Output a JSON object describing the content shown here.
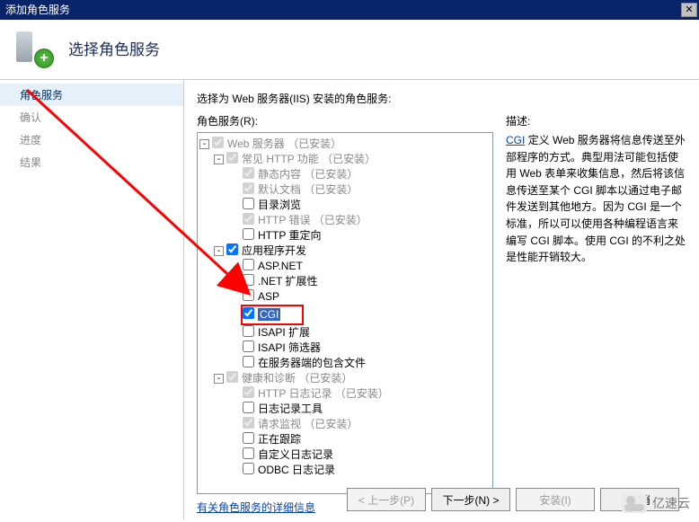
{
  "window": {
    "title": "添加角色服务"
  },
  "header": {
    "title": "选择角色服务"
  },
  "sidebar": {
    "items": [
      {
        "label": "角色服务",
        "active": true
      },
      {
        "label": "确认"
      },
      {
        "label": "进度"
      },
      {
        "label": "结果"
      }
    ]
  },
  "main": {
    "instruction": "选择为 Web 服务器(IIS) 安装的角色服务:",
    "tree_label": "角色服务(R):",
    "info_link": "有关角色服务的详细信息",
    "desc_title": "描述:",
    "desc_link": "CGI",
    "desc_body": " 定义 Web 服务器将信息传送至外部程序的方式。典型用法可能包括使用 Web 表单来收集信息，然后将该信息传送至某个 CGI 脚本以通过电子邮件发送到其他地方。因为 CGI 是一个标准，所以可以使用各种编程语言来编写 CGI 脚本。使用 CGI 的不利之处是性能开销较大。"
  },
  "tree": {
    "root": {
      "label": "Web 服务器",
      "suffix": "（已安装）"
    },
    "http": {
      "label": "常见 HTTP 功能",
      "suffix": "（已安装）",
      "items": [
        {
          "label": "静态内容",
          "suffix": "（已安装）",
          "checked": true,
          "disabled": true
        },
        {
          "label": "默认文档",
          "suffix": "（已安装）",
          "checked": true,
          "disabled": true
        },
        {
          "label": "目录浏览",
          "checked": false
        },
        {
          "label": "HTTP 错误",
          "suffix": "（已安装）",
          "checked": true,
          "disabled": true
        },
        {
          "label": "HTTP 重定向",
          "checked": false
        }
      ]
    },
    "app": {
      "label": "应用程序开发",
      "items": [
        {
          "label": "ASP.NET",
          "checked": false
        },
        {
          "label": ".NET 扩展性",
          "checked": false
        },
        {
          "label": "ASP",
          "checked": false
        },
        {
          "label": "CGI",
          "checked": true,
          "selected": true,
          "highlight": true
        },
        {
          "label": "ISAPI 扩展",
          "checked": false
        },
        {
          "label": "ISAPI 筛选器",
          "checked": false
        },
        {
          "label": "在服务器端的包含文件",
          "checked": false
        }
      ]
    },
    "health": {
      "label": "健康和诊断",
      "suffix": "（已安装）",
      "items": [
        {
          "label": "HTTP 日志记录",
          "suffix": "（已安装）",
          "checked": true,
          "disabled": true
        },
        {
          "label": "日志记录工具",
          "checked": false
        },
        {
          "label": "请求监视",
          "suffix": "（已安装）",
          "checked": true,
          "disabled": true
        },
        {
          "label": "正在跟踪",
          "checked": false
        },
        {
          "label": "自定义日志记录",
          "checked": false
        },
        {
          "label": "ODBC 日志记录",
          "checked": false
        }
      ]
    }
  },
  "buttons": {
    "prev": "< 上一步(P)",
    "next": "下一步(N) >",
    "install": "安装(I)",
    "cancel": "取消"
  },
  "watermark": "亿速云"
}
